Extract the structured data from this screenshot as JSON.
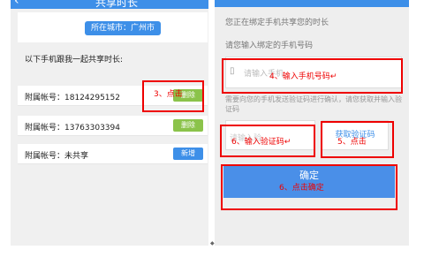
{
  "left": {
    "header_title": "共享时长",
    "city": "所在城市：广州市",
    "description": "以下手机跟我一起共享时长:",
    "rows": [
      {
        "label": "附属帐号：18124295152",
        "button": "删除"
      },
      {
        "label": "附属帐号：13763303394",
        "button": "删除"
      },
      {
        "label": "附属帐号：未共享",
        "button": "新增"
      }
    ],
    "annotation_step3": "3、点击"
  },
  "right": {
    "line1": "您正在绑定手机共享您的时长",
    "line2": "请您输入绑定的手机号码",
    "phone_placeholder": "请输入手机",
    "annotation_step4": "4、输入手机号码↵",
    "sms_description": "需要向您的手机发送验证码进行确认，请您获取并输入验证码",
    "code_placeholder": "请输入验",
    "annotation_step6_code": "6、输入验证码↵",
    "get_code_label": "获取验证码",
    "annotation_step5": "5、点击",
    "confirm_label": "确定",
    "annotation_step6_confirm": "6、点击确定"
  },
  "colors": {
    "primary": "#3d8fe8",
    "delete_green": "#8bc34a",
    "annotation_red": "#e00000"
  },
  "icons": {
    "back": "back-arrow-icon",
    "phone": "phone-icon"
  }
}
